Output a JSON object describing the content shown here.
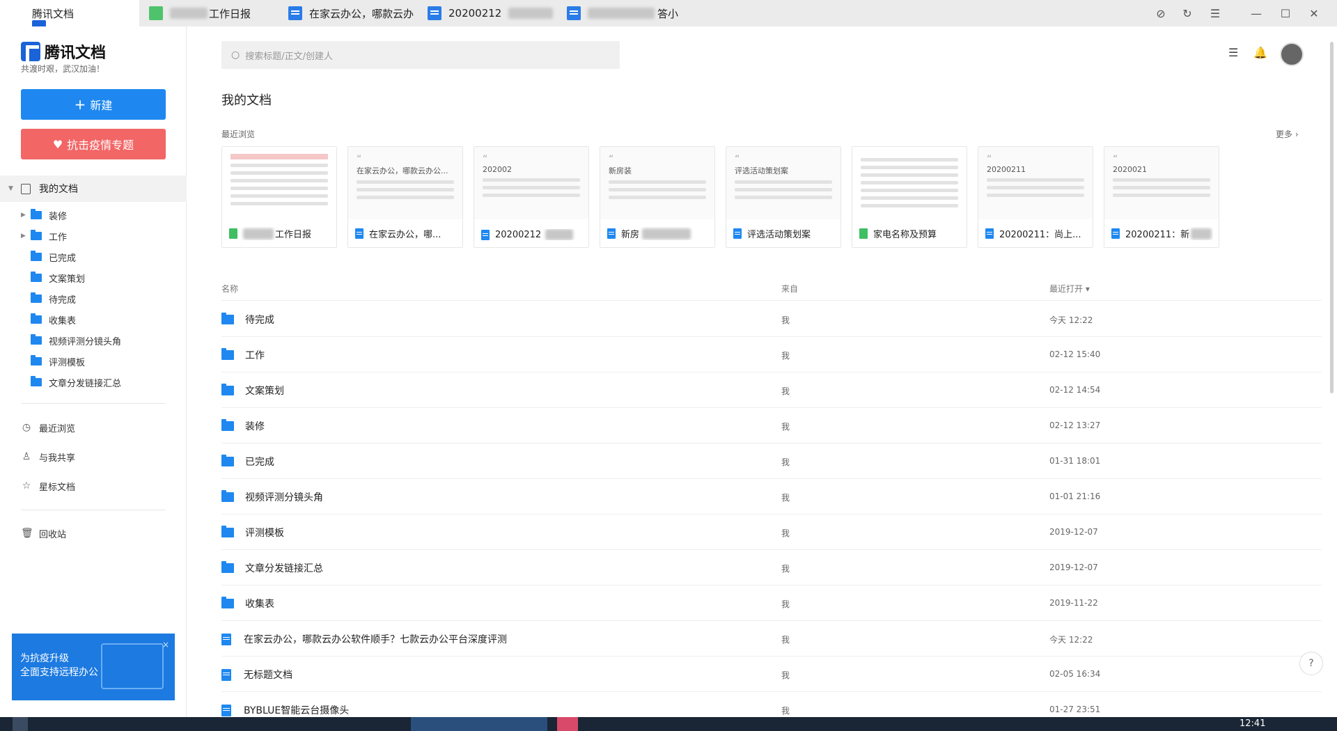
{
  "window": {
    "tabs": [
      {
        "label": "腾讯文档",
        "icon": "brand-icon"
      },
      {
        "label": "工作日报",
        "icon": "sheet-icon"
      },
      {
        "label": "在家云办公，哪款云办",
        "icon": "doc-icon"
      },
      {
        "label": "20200212",
        "icon": "doc-icon"
      },
      {
        "label": "答小",
        "icon": "doc-icon"
      }
    ]
  },
  "sidebar": {
    "brand": "腾讯文档",
    "slogan": "共渡时艰，武汉加油！",
    "new_button": "新建",
    "fight_button": "抗击疫情专题",
    "my_docs": "我的文档",
    "folders": [
      "装修",
      "工作",
      "已完成",
      "文案策划",
      "待完成",
      "收集表",
      "视频评测分镜头角",
      "评测模板",
      "文章分发链接汇总"
    ],
    "nav": [
      {
        "label": "最近浏览",
        "icon": "clock-icon"
      },
      {
        "label": "与我共享",
        "icon": "user-icon"
      },
      {
        "label": "星标文档",
        "icon": "star-icon"
      },
      {
        "label": "回收站",
        "icon": "trash-icon"
      }
    ],
    "promo": {
      "line1": "为抗疫升级",
      "line2": "全面支持远程办公",
      "close": "×"
    }
  },
  "header": {
    "search_placeholder": "搜索标题/正文/创建人"
  },
  "main": {
    "title": "我的文档",
    "recent_label": "最近浏览",
    "more_label": "更多 ›",
    "recent_cards": [
      {
        "name": "工作日报",
        "type": "sheet"
      },
      {
        "name": "在家云办公，哪...",
        "type": "doc",
        "preview": "在家云办公，哪款云办公..."
      },
      {
        "name": "20200212",
        "type": "doc",
        "preview": "202002"
      },
      {
        "name": "新房",
        "type": "doc",
        "preview": "新房装"
      },
      {
        "name": "评选活动策划案",
        "type": "doc",
        "preview": "评选活动策划案"
      },
      {
        "name": "家电名称及预算",
        "type": "sheet"
      },
      {
        "name": "20200211：尚上...",
        "type": "doc",
        "preview": "20200211"
      },
      {
        "name": "20200211：新",
        "type": "doc",
        "preview": "2020021"
      }
    ],
    "columns": {
      "name": "名称",
      "from": "来自",
      "time": "最近打开 ▾"
    },
    "rows": [
      {
        "name": "待完成",
        "type": "folder",
        "from": "我",
        "time": "今天 12:22"
      },
      {
        "name": "工作",
        "type": "folder",
        "from": "我",
        "time": "02-12 15:40"
      },
      {
        "name": "文案策划",
        "type": "folder",
        "from": "我",
        "time": "02-12 14:54"
      },
      {
        "name": "装修",
        "type": "folder",
        "from": "我",
        "time": "02-12 13:27"
      },
      {
        "name": "已完成",
        "type": "folder",
        "from": "我",
        "time": "01-31 18:01"
      },
      {
        "name": "视频评测分镜头角",
        "type": "folder",
        "from": "我",
        "time": "01-01 21:16"
      },
      {
        "name": "评测模板",
        "type": "folder",
        "from": "我",
        "time": "2019-12-07"
      },
      {
        "name": "文章分发链接汇总",
        "type": "folder",
        "from": "我",
        "time": "2019-12-07"
      },
      {
        "name": "收集表",
        "type": "folder",
        "from": "我",
        "time": "2019-11-22"
      },
      {
        "name": "在家云办公，哪款云办公软件顺手？七款云办公平台深度评测",
        "type": "doc",
        "from": "我",
        "time": "今天 12:22"
      },
      {
        "name": "无标题文档",
        "type": "doc",
        "from": "我",
        "time": "02-05 16:34"
      },
      {
        "name": "BYBLUE智能云台摄像头",
        "type": "doc",
        "from": "我",
        "time": "01-27 23:51"
      }
    ],
    "help": "?"
  },
  "taskbar": {
    "clock": "12:41"
  }
}
